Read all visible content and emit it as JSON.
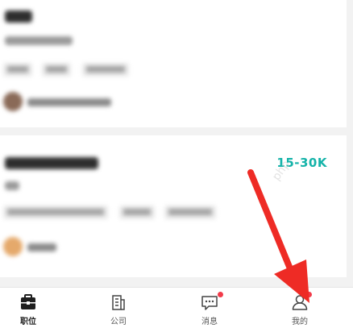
{
  "jobs": [
    {
      "salary": ""
    },
    {
      "salary": "15-30K"
    }
  ],
  "tabs": [
    {
      "label": "职位",
      "icon": "briefcase-icon",
      "active": true
    },
    {
      "label": "公司",
      "icon": "company-icon",
      "active": false
    },
    {
      "label": "消息",
      "icon": "message-icon",
      "active": false,
      "badge": true
    },
    {
      "label": "我的",
      "icon": "profile-icon",
      "active": false,
      "badge": true
    }
  ],
  "colors": {
    "accent": "#15b3a9",
    "badge": "#f23b4a",
    "arrow": "#ee2b25"
  },
  "watermark": "php"
}
